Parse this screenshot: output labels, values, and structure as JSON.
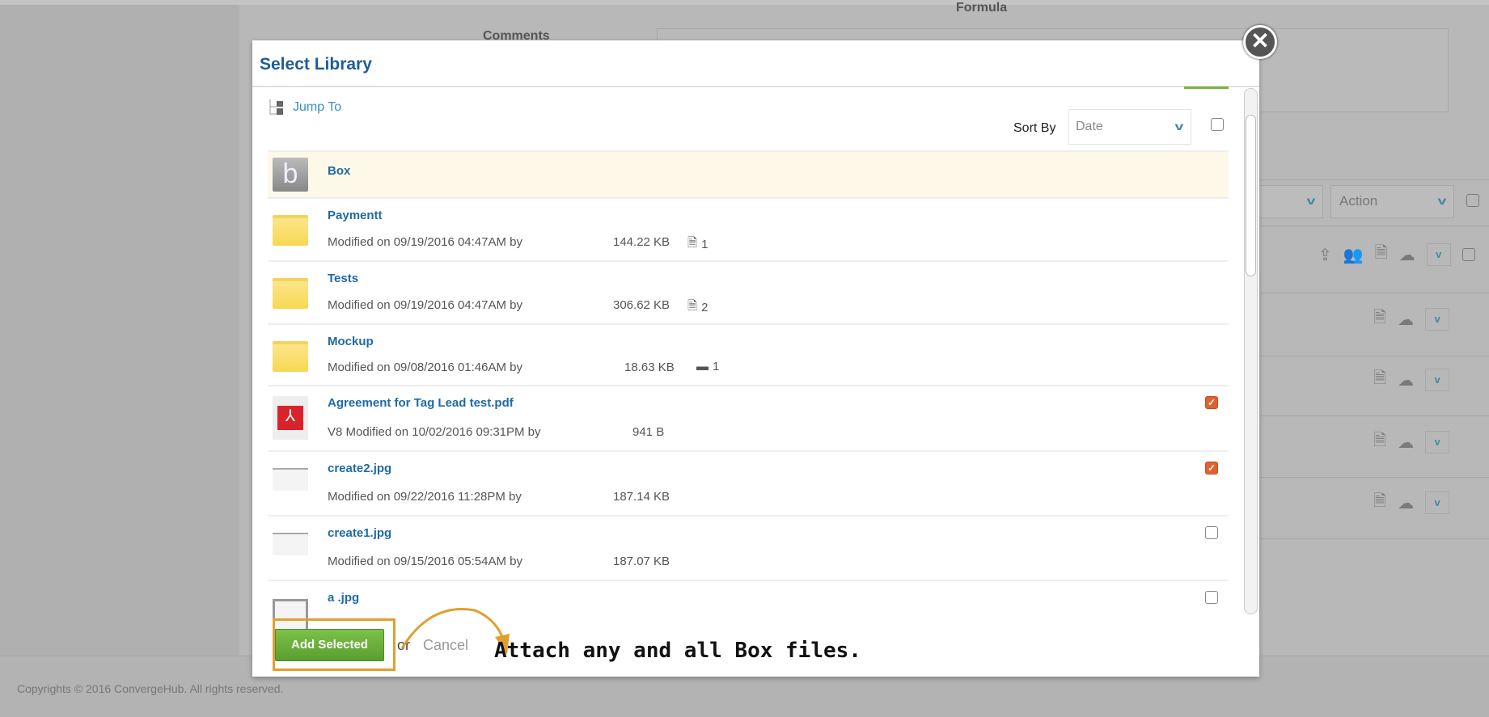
{
  "background": {
    "formula_label": "Formula",
    "comments_label": "Comments",
    "action_select": "Action",
    "footer": "Copyrights © 2016 ConvergeHub. All rights reserved."
  },
  "dialog": {
    "title": "Select Library",
    "jump_to": "Jump To",
    "sort_by_label": "Sort By",
    "sort_by_value": "Date",
    "items": [
      {
        "name": "Box",
        "type": "box"
      },
      {
        "name": "Paymentt",
        "type": "folder",
        "meta": "Modified on 09/19/2016 04:47AM by",
        "size": "144.22 KB",
        "count": "1",
        "count_icon": "file-icon"
      },
      {
        "name": "Tests",
        "type": "folder",
        "meta": "Modified on 09/19/2016 04:47AM by",
        "size": "306.62 KB",
        "count": "2",
        "count_icon": "file-icon"
      },
      {
        "name": "Mockup",
        "type": "folder",
        "meta": "Modified on 09/08/2016 01:46AM by",
        "size": "18.63 KB",
        "count": "1",
        "count_icon": "folder-icon"
      },
      {
        "name": "Agreement for Tag Lead test.pdf",
        "type": "pdf",
        "meta": "V8 Modified on 10/02/2016 09:31PM by",
        "size": "941 B",
        "checked": true
      },
      {
        "name": "create2.jpg",
        "type": "image",
        "meta": "Modified on 09/22/2016 11:28PM by",
        "size": "187.14 KB",
        "checked": true
      },
      {
        "name": "create1.jpg",
        "type": "image",
        "meta": "Modified on 09/15/2016 05:54AM by",
        "size": "187.07 KB",
        "checked": false
      },
      {
        "name": "a .jpg",
        "type": "image",
        "checked": false
      }
    ],
    "add_selected": "Add Selected",
    "or": "or",
    "cancel": "Cancel"
  },
  "annotation": "Attach any and all Box files.",
  "colors": {
    "accent": "#1f5d94",
    "checked": "#e0622f",
    "button": "#6bb03c",
    "highlight": "#e0a030"
  }
}
